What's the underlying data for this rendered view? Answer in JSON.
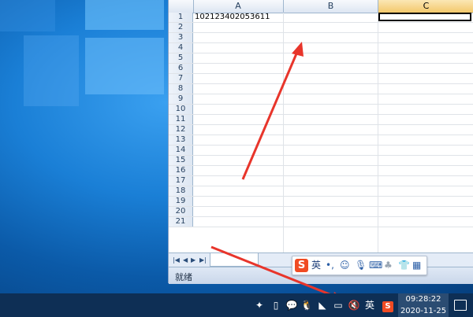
{
  "spreadsheet": {
    "columns": [
      "A",
      "B",
      "C"
    ],
    "selected_column": "C",
    "rows": [
      "1",
      "2",
      "3",
      "4",
      "5",
      "6",
      "7",
      "8",
      "9",
      "10",
      "11",
      "12",
      "13",
      "14",
      "15",
      "16",
      "17",
      "18",
      "19",
      "20",
      "21"
    ],
    "cell_a1": "102123402053611",
    "sheet_tab_label": "",
    "status_text": "就绪"
  },
  "ime_toolbar": {
    "logo": "S",
    "mode_label": "英",
    "icons": [
      "punctuation-icon",
      "emoji-icon",
      "microphone-icon",
      "keyboard-icon",
      "skin-icon",
      "shirt-icon",
      "menu-grid-icon"
    ]
  },
  "taskbar": {
    "input_language": "英",
    "time": "09:28:22",
    "date": "2020-11-25"
  },
  "colors": {
    "arrow": "#e8352b",
    "taskbar": "#0e2f55",
    "sogou": "#f04b23",
    "selected_header": "#f3c86b"
  }
}
